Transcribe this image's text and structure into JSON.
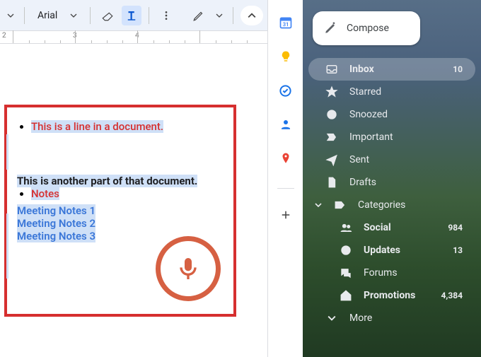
{
  "toolbar": {
    "font": "Arial"
  },
  "ruler": [
    "2",
    "3",
    "4"
  ],
  "document": {
    "bullet1": "This is a line in a document.",
    "section": "This is another part of that document.",
    "bullet2": "Notes",
    "note1": "Meeting Notes 1",
    "note2": "Meeting Notes 2",
    "note3": "Meeting Notes 3"
  },
  "gmail": {
    "compose": "Compose",
    "items": [
      {
        "label": "Inbox",
        "count": "10"
      },
      {
        "label": "Starred",
        "count": ""
      },
      {
        "label": "Snoozed",
        "count": ""
      },
      {
        "label": "Important",
        "count": ""
      },
      {
        "label": "Sent",
        "count": ""
      },
      {
        "label": "Drafts",
        "count": ""
      }
    ],
    "categories_label": "Categories",
    "categories": [
      {
        "label": "Social",
        "count": "984"
      },
      {
        "label": "Updates",
        "count": "13"
      },
      {
        "label": "Forums",
        "count": ""
      },
      {
        "label": "Promotions",
        "count": "4,384"
      }
    ],
    "more": "More"
  }
}
